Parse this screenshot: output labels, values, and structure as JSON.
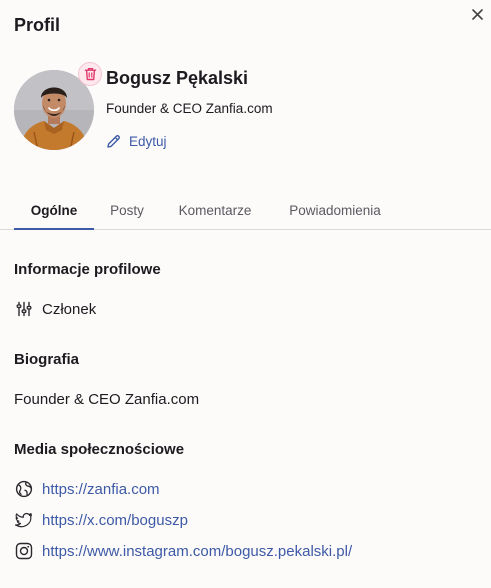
{
  "header": {
    "title": "Profil"
  },
  "icons": {
    "close": "close-icon",
    "delete": "trash-icon",
    "edit": "pencil-icon",
    "member": "sliders-icon",
    "website": "globe-icon",
    "twitter": "twitter-icon",
    "instagram": "instagram-icon"
  },
  "colors": {
    "accent": "#3c5aa6",
    "danger": "#e0386b",
    "background": "#fdfafa"
  },
  "profile": {
    "name": "Bogusz Pękalski",
    "role": "Founder & CEO Zanfia.com",
    "edit_label": "Edytuj"
  },
  "tabs": [
    {
      "label": "Ogólne",
      "active": true
    },
    {
      "label": "Posty",
      "active": false
    },
    {
      "label": "Komentarze",
      "active": false
    },
    {
      "label": "Powiadomienia",
      "active": false
    }
  ],
  "profile_info": {
    "title": "Informacje profilowe",
    "membership": "Członek"
  },
  "bio": {
    "title": "Biografia",
    "text": "Founder & CEO Zanfia.com"
  },
  "social": {
    "title": "Media społecznościowe",
    "links": [
      {
        "icon": "globe-icon",
        "url": "https://zanfia.com"
      },
      {
        "icon": "twitter-icon",
        "url": "https://x.com/boguszp"
      },
      {
        "icon": "instagram-icon",
        "url": "https://www.instagram.com/bogusz.pekalski.pl/"
      }
    ]
  }
}
